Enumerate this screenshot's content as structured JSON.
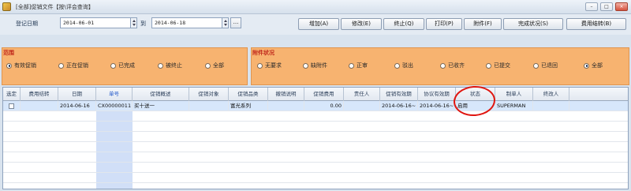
{
  "window": {
    "title": "[全部]促销文件【按\\评会查询】",
    "controls": [
      "–",
      "□",
      "×"
    ]
  },
  "toolbar": {
    "reg_date_label": "登记日期",
    "date_from": "2014-06-01",
    "to_label": "到",
    "date_to": "2014-06-18",
    "dots_label": "...",
    "buttons": [
      "增加(A)",
      "修改(E)",
      "终止(Q)",
      "打印(P)",
      "附件(F)",
      "完成状况(S)",
      "费用结转(B)"
    ]
  },
  "range_group": {
    "title": "范围",
    "options": [
      {
        "label": "有效促销",
        "selected": true
      },
      {
        "label": "正在促销",
        "selected": false
      },
      {
        "label": "已完成",
        "selected": false
      },
      {
        "label": "被终止",
        "selected": false
      },
      {
        "label": "全部",
        "selected": false
      }
    ]
  },
  "attach_group": {
    "title": "附件状况",
    "options": [
      {
        "label": "无要求",
        "selected": false
      },
      {
        "label": "缺附件",
        "selected": false
      },
      {
        "label": "正审",
        "selected": false
      },
      {
        "label": "驳出",
        "selected": false
      },
      {
        "label": "已收齐",
        "selected": false
      },
      {
        "label": "已提交",
        "selected": false
      },
      {
        "label": "已退回",
        "selected": false
      },
      {
        "label": "全部",
        "selected": true
      }
    ]
  },
  "table": {
    "columns": [
      "选定",
      "费用结转",
      "日期",
      "单号",
      "促销概述",
      "促销对象",
      "促销品类",
      "撤销说明",
      "促销费用",
      "责任人",
      "促销有效期",
      "协议有效期",
      "状态",
      "制单人",
      "终改人"
    ],
    "rows": [
      {
        "selected": false,
        "cells": [
          "",
          "",
          "2014-06-16",
          "CX00000011",
          "买十送一",
          "",
          "富光系列",
          "",
          "0.00",
          "",
          "2014-06-16~",
          "2014-06-16~",
          "启用",
          "SUPERMAN",
          ""
        ]
      }
    ]
  },
  "colors": {
    "filter_bg": "#f7b370",
    "filter_title": "#c0281b",
    "selected_row": "#d7e7fb",
    "annotation": "#e0150f"
  }
}
